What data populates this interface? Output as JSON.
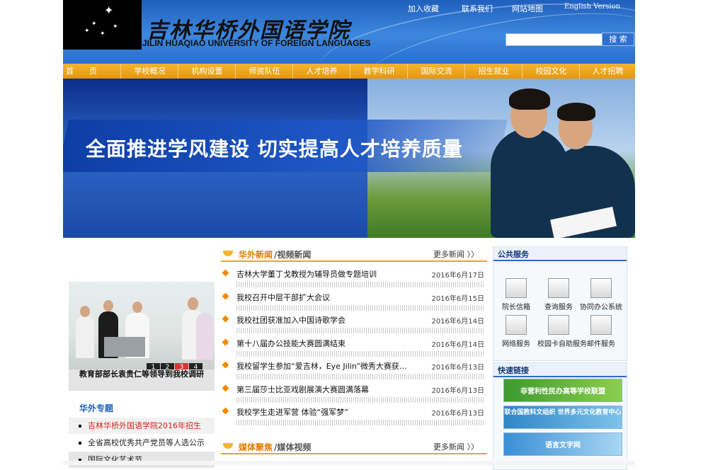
{
  "header": {
    "brand_cn": "吉林华桥外国语学院",
    "brand_en": "JILIN HUAQIAO UNIVERSITY OF FOREIGN LANGUAGES",
    "top_links": [
      "加入收藏",
      "联系我们",
      "网站地图",
      "English Version"
    ],
    "search_placeholder": "",
    "search_button": "搜 索"
  },
  "nav": {
    "items": [
      "首　　页",
      "学校概况",
      "机构设置",
      "师资队伍",
      "人才培养",
      "教学科研",
      "国际交流",
      "招生就业",
      "校园文化",
      "人才招聘"
    ]
  },
  "banner": {
    "slogan": "全面推进学风建设 切实提高人才培养质量"
  },
  "slideshow": {
    "numbers": [
      "1",
      "2",
      "3",
      "4",
      "5"
    ],
    "active": "3",
    "caption": "教育部部长袁贵仁等领导到我校调研"
  },
  "topics": {
    "title": "华外专题",
    "items": [
      "吉林华桥外国语学院2016年招生",
      "全省高校优秀共产党员等人选公示",
      "国际文化艺术节"
    ]
  },
  "news": {
    "tab_primary": "华外新闻",
    "tab_secondary": "/视频新闻",
    "more": "更多新闻 〉〉",
    "items": [
      {
        "title": "吉林大学董丁戈教授为辅导员做专题培训",
        "date": "2016年6月17日"
      },
      {
        "title": "我校召开中层干部扩大会议",
        "date": "2016年6月15日"
      },
      {
        "title": "我校社团获准加入中国诗歌学会",
        "date": "2016年6月14日"
      },
      {
        "title": "第十八届办公技能大赛圆满结束",
        "date": "2016年6月14日"
      },
      {
        "title": "我校留学生参加“爱吉林，Eye Jilin”微秀大赛获…",
        "date": "2016年6月13日"
      },
      {
        "title": "第三届莎士比亚戏剧展演大赛圆满落幕",
        "date": "2016年6月13日"
      },
      {
        "title": "我校学生走进军营 体验“强军梦”",
        "date": "2016年6月13日"
      }
    ]
  },
  "media": {
    "tab_primary": "媒体聚焦",
    "tab_secondary": "/媒体视频",
    "more": "更多新闻 〉〉"
  },
  "services": {
    "title": "公共服务",
    "items": [
      {
        "label": "院长信箱",
        "icon": "mailbox-icon"
      },
      {
        "label": "查询服务",
        "icon": "camera-icon"
      },
      {
        "label": "协同办公系统",
        "icon": "book-icon"
      },
      {
        "label": "网络服务",
        "icon": "document-icon"
      },
      {
        "label": "校园卡自助服务",
        "icon": "tools-icon"
      },
      {
        "label": "邮件服务",
        "icon": "envelope-icon"
      }
    ]
  },
  "quicklinks": {
    "title": "快速链接",
    "items": [
      {
        "label": "非营利性民办高等学校联盟",
        "color": "#3c9a2e"
      },
      {
        "label": "联合国教科文组织 世界多元文化教育中心",
        "color": "#2e86c8"
      },
      {
        "label": "语言文字网",
        "color": "#3a8fd6"
      }
    ]
  },
  "colors": {
    "nav": "#e6970d",
    "header": "#2a6fcf",
    "accent": "#f08a00"
  }
}
